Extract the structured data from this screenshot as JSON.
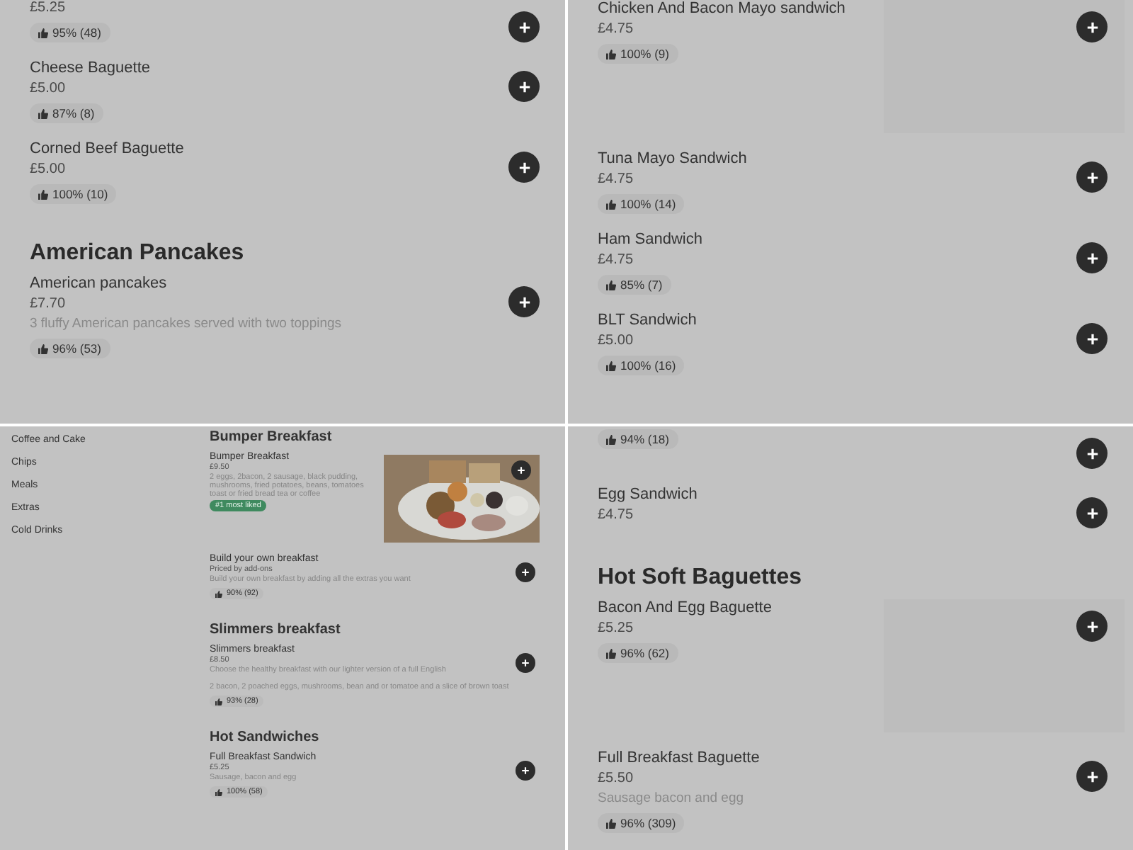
{
  "panels": [
    {
      "kind": "full",
      "sections": [
        {
          "items": [
            {
              "price": "£5.25",
              "rating": "95% (48)"
            },
            {
              "name": "Cheese Baguette",
              "price": "£5.00",
              "rating": "87% (8)"
            },
            {
              "name": "Corned Beef Baguette",
              "price": "£5.00",
              "rating": "100% (10)"
            }
          ]
        },
        {
          "heading": "American Pancakes",
          "items": [
            {
              "name": "American pancakes",
              "price": "£7.70",
              "description": "3 fluffy American pancakes served with two toppings",
              "rating": "96% (53)"
            }
          ]
        }
      ]
    },
    {
      "kind": "full",
      "sections": [
        {
          "items": [
            {
              "name": "Chicken And Bacon Mayo sandwich",
              "price": "£4.75",
              "rating": "100% (9)",
              "kind": "blank-image"
            },
            {
              "name": "Tuna Mayo Sandwich",
              "price": "£4.75",
              "rating": "100% (14)"
            },
            {
              "name": "Ham Sandwich",
              "price": "£4.75",
              "rating": "85% (7)"
            },
            {
              "name": "BLT Sandwich",
              "price": "£5.00",
              "rating": "100% (16)"
            }
          ]
        }
      ]
    },
    {
      "kind": "compact",
      "sidebar": [
        "Coffee and Cake",
        "Chips",
        "Meals",
        "Extras",
        "Cold Drinks"
      ],
      "sections": [
        {
          "heading": "Bumper Breakfast",
          "items": [
            {
              "name": "Bumper Breakfast",
              "price": "£9.50",
              "description": "2 eggs, 2bacon, 2 sausage, black pudding, mushrooms, fried potatoes, beans, tomatoes toast or fried bread tea or coffee",
              "badge": "#1 most liked"
            },
            {
              "name": "Build your own breakfast",
              "price": "Priced by add-ons",
              "description": "Build your own breakfast by adding all the extras you want",
              "rating": "90% (92)"
            }
          ]
        },
        {
          "heading": "Slimmers breakfast",
          "items": [
            {
              "name": "Slimmers breakfast",
              "price": "£8.50",
              "description": "Choose the healthy breakfast with our lighter version of a full English",
              "note": "2 bacon, 2 poached eggs, mushrooms, bean and or tomatoe and a slice of brown toast",
              "rating": "93% (28)"
            }
          ]
        },
        {
          "heading": "Hot Sandwiches",
          "items": [
            {
              "name": "Full Breakfast Sandwich",
              "price": "£5.25",
              "description": "Sausage, bacon and egg",
              "rating": "100% (58)"
            }
          ]
        }
      ]
    },
    {
      "kind": "full",
      "sections": [
        {
          "items": [
            {
              "rating": "94% (18)"
            },
            {
              "name": "Egg Sandwich",
              "price": "£4.75"
            }
          ]
        },
        {
          "heading": "Hot Soft Baguettes",
          "items": [
            {
              "name": "Bacon And Egg Baguette",
              "price": "£5.25",
              "rating": "96% (62)",
              "kind": "blank-image"
            },
            {
              "name": "Full Breakfast Baguette",
              "price": "£5.50",
              "description": "Sausage bacon and egg",
              "rating": "96% (309)"
            }
          ]
        }
      ]
    }
  ]
}
